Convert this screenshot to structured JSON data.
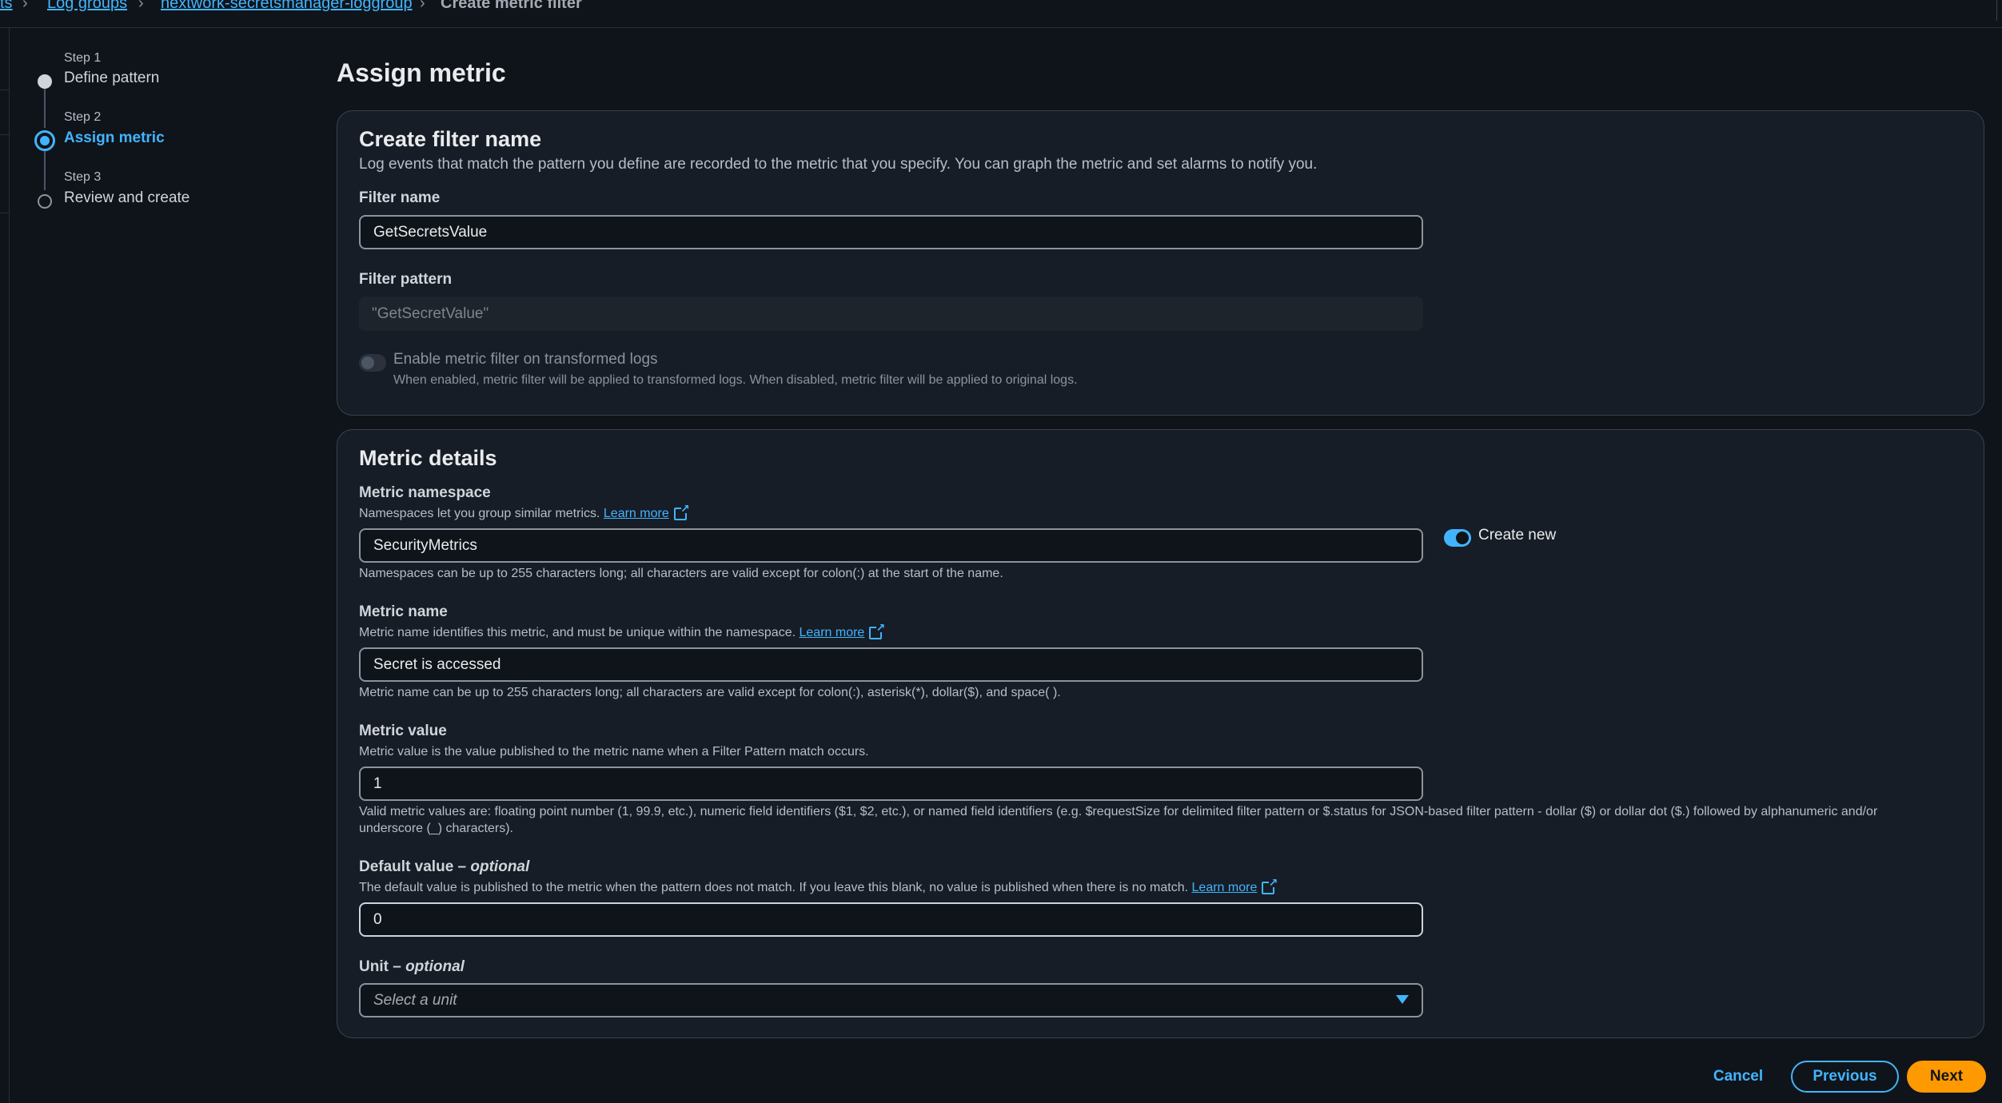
{
  "breadcrumb": {
    "items": [
      "ts",
      "Log groups",
      "nextwork-secretsmanager-loggroup"
    ],
    "current": "Create metric filter"
  },
  "steps": [
    {
      "number": "Step 1",
      "title": "Define pattern",
      "state": "complete"
    },
    {
      "number": "Step 2",
      "title": "Assign metric",
      "state": "active"
    },
    {
      "number": "Step 3",
      "title": "Review and create",
      "state": "pending"
    }
  ],
  "page_title": "Assign metric",
  "filter_section": {
    "title": "Create filter name",
    "description": "Log events that match the pattern you define are recorded to the metric that you specify. You can graph the metric and set alarms to notify you.",
    "filter_name": {
      "label": "Filter name",
      "value": "GetSecretsValue"
    },
    "filter_pattern": {
      "label": "Filter pattern",
      "value": "\"GetSecretValue\""
    },
    "transform_toggle": {
      "label": "Enable metric filter on transformed logs",
      "help": "When enabled, metric filter will be applied to transformed logs. When disabled, metric filter will be applied to original logs.",
      "enabled": false
    }
  },
  "metric_section": {
    "title": "Metric details",
    "namespace": {
      "label": "Metric namespace",
      "description": "Namespaces let you group similar metrics.",
      "learn_more": "Learn more",
      "value": "SecurityMetrics",
      "constraint": "Namespaces can be up to 255 characters long; all characters are valid except for colon(:) at the start of the name.",
      "create_new_label": "Create new",
      "create_new_enabled": true
    },
    "metric_name": {
      "label": "Metric name",
      "description": "Metric name identifies this metric, and must be unique within the namespace.",
      "learn_more": "Learn more",
      "value": "Secret is accessed",
      "constraint": "Metric name can be up to 255 characters long; all characters are valid except for colon(:), asterisk(*), dollar($), and space( )."
    },
    "metric_value": {
      "label": "Metric value",
      "description": "Metric value is the value published to the metric name when a Filter Pattern match occurs.",
      "value": "1",
      "constraint_line1": "Valid metric values are: floating point number (1, 99.9, etc.), numeric field identifiers ($1, $2, etc.), or named field identifiers (e.g. $requestSize for delimited filter pattern or $.status for JSON-based filter pattern - dollar ($) or dollar dot ($.) followed by alphanumeric and/or",
      "constraint_line2": "underscore (_) characters)."
    },
    "default_value": {
      "label": "Default value – ",
      "optional": "optional",
      "description": "The default value is published to the metric when the pattern does not match. If you leave this blank, no value is published when there is no match.",
      "learn_more": "Learn more",
      "value": "0"
    },
    "unit": {
      "label": "Unit – ",
      "optional": "optional",
      "placeholder": "Select a unit"
    }
  },
  "actions": {
    "cancel": "Cancel",
    "previous": "Previous",
    "next": "Next"
  },
  "colors": {
    "background": "#0f141a",
    "panel": "#161d26",
    "accent_link": "#42b4ff",
    "primary_button": "#ff9900",
    "border": "#3b414b"
  }
}
